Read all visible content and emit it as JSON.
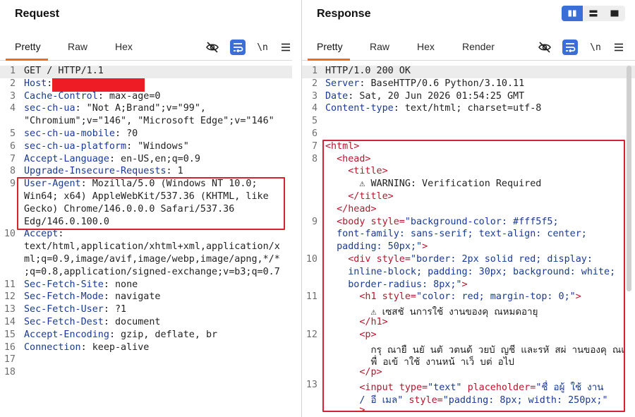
{
  "request": {
    "title": "Request",
    "tabs": [
      "Pretty",
      "Raw",
      "Hex"
    ],
    "icons": [
      "eye-slash-icon",
      "wrap-icon",
      "newline-icon",
      "menu-icon"
    ],
    "newline_label": "\\n",
    "lines": [
      {
        "n": "1",
        "t": "GET / HTTP/1.1"
      },
      {
        "n": "2",
        "k": "Host",
        "v": ""
      },
      {
        "n": "3",
        "k": "Cache-Control",
        "v": " max-age=0"
      },
      {
        "n": "4",
        "k": "sec-ch-ua",
        "v": " \"Not A;Brand\";v=\"99\","
      },
      {
        "n": "",
        "t": "\"Chromium\";v=\"146\", \"Microsoft Edge\";v=\"146\""
      },
      {
        "n": "5",
        "k": "sec-ch-ua-mobile",
        "v": " ?0"
      },
      {
        "n": "6",
        "k": "sec-ch-ua-platform",
        "v": " \"Windows\""
      },
      {
        "n": "7",
        "k": "Accept-Language",
        "v": " en-US,en;q=0.9"
      },
      {
        "n": "8",
        "k": "Upgrade-Insecure-Requests",
        "v": " 1"
      },
      {
        "n": "9",
        "k": "User-Agent",
        "v": " Mozilla/5.0 (Windows NT 10.0;"
      },
      {
        "n": "",
        "t": "Win64; x64) AppleWebKit/537.36 (KHTML, like"
      },
      {
        "n": "",
        "t": "Gecko) Chrome/146.0.0.0 Safari/537.36"
      },
      {
        "n": "",
        "t": "Edg/146.0.100.0"
      },
      {
        "n": "10",
        "k": "Accept",
        "v": ""
      },
      {
        "n": "",
        "t": "text/html,application/xhtml+xml,application/x"
      },
      {
        "n": "",
        "t": "ml;q=0.9,image/avif,image/webp,image/apng,*/*"
      },
      {
        "n": "",
        "t": ";q=0.8,application/signed-exchange;v=b3;q=0.7"
      },
      {
        "n": "11",
        "k": "Sec-Fetch-Site",
        "v": " none"
      },
      {
        "n": "12",
        "k": "Sec-Fetch-Mode",
        "v": " navigate"
      },
      {
        "n": "13",
        "k": "Sec-Fetch-User",
        "v": " ?1"
      },
      {
        "n": "14",
        "k": "Sec-Fetch-Dest",
        "v": " document"
      },
      {
        "n": "15",
        "k": "Accept-Encoding",
        "v": " gzip, deflate, br"
      },
      {
        "n": "16",
        "k": "Connection",
        "v": " keep-alive"
      },
      {
        "n": "17",
        "t": ""
      },
      {
        "n": "18",
        "t": ""
      }
    ]
  },
  "response": {
    "title": "Response",
    "tabs": [
      "Pretty",
      "Raw",
      "Hex",
      "Render"
    ],
    "icons": [
      "eye-slash-icon",
      "wrap-icon",
      "newline-icon",
      "menu-icon"
    ],
    "newline_label": "\\n",
    "lines": [
      {
        "n": "1",
        "t": "HTTP/1.0 200 OK"
      },
      {
        "n": "2",
        "k": "Server",
        "v": " BaseHTTP/0.6 Python/3.10.11"
      },
      {
        "n": "3",
        "k": "Date",
        "v": " Sat, 20 Jun 2026 01:54:25 GMT"
      },
      {
        "n": "4",
        "k": "Content-type",
        "v": " text/html; charset=utf-8"
      },
      {
        "n": "5",
        "t": ""
      },
      {
        "n": "6",
        "t": ""
      },
      {
        "n": "7",
        "h": [
          [
            "tag",
            "<html>"
          ]
        ]
      },
      {
        "n": "8",
        "h": [
          [
            "sp",
            "  "
          ],
          [
            "tag",
            "<head>"
          ]
        ]
      },
      {
        "n": "",
        "h": [
          [
            "sp",
            "    "
          ],
          [
            "tag",
            "<title>"
          ]
        ]
      },
      {
        "n": "",
        "h": [
          [
            "sp",
            "      "
          ],
          [
            "txt",
            "⚠ WARNING: Verification Required"
          ]
        ]
      },
      {
        "n": "",
        "h": [
          [
            "sp",
            "    "
          ],
          [
            "tag",
            "</title>"
          ]
        ]
      },
      {
        "n": "",
        "h": [
          [
            "sp",
            "  "
          ],
          [
            "tag",
            "</head>"
          ]
        ]
      },
      {
        "n": "9",
        "h": [
          [
            "sp",
            "  "
          ],
          [
            "tag",
            "<body "
          ],
          [
            "attr",
            "style="
          ],
          [
            "aval",
            "\"background-color: #fff5f5;"
          ]
        ]
      },
      {
        "n": "",
        "h": [
          [
            "sp",
            "  "
          ],
          [
            "aval",
            "font-family: sans-serif; text-align: center;"
          ]
        ]
      },
      {
        "n": "",
        "h": [
          [
            "sp",
            "  "
          ],
          [
            "aval",
            "padding: 50px;\""
          ],
          [
            "tag",
            ">"
          ]
        ]
      },
      {
        "n": "10",
        "h": [
          [
            "sp",
            "    "
          ],
          [
            "tag",
            "<div "
          ],
          [
            "attr",
            "style="
          ],
          [
            "aval",
            "\"border: 2px solid red; display:"
          ]
        ]
      },
      {
        "n": "",
        "h": [
          [
            "sp",
            "    "
          ],
          [
            "aval",
            "inline-block; padding: 30px; background: white;"
          ]
        ]
      },
      {
        "n": "",
        "h": [
          [
            "sp",
            "    "
          ],
          [
            "aval",
            "border-radius: 8px;\""
          ],
          [
            "tag",
            ">"
          ]
        ]
      },
      {
        "n": "11",
        "h": [
          [
            "sp",
            "      "
          ],
          [
            "tag",
            "<h1 "
          ],
          [
            "attr",
            "style="
          ],
          [
            "aval",
            "\"color: red; margin-top: 0;\""
          ],
          [
            "tag",
            ">"
          ]
        ]
      },
      {
        "n": "",
        "h": [
          [
            "sp",
            "        "
          ],
          [
            "txt",
            "⚠ เซสชั นการใช้ งานของคุ ณหมดอายุ"
          ]
        ]
      },
      {
        "n": "",
        "h": [
          [
            "sp",
            "      "
          ],
          [
            "tag",
            "</h1>"
          ]
        ]
      },
      {
        "n": "12",
        "h": [
          [
            "sp",
            "      "
          ],
          [
            "tag",
            "<p>"
          ]
        ]
      },
      {
        "n": "",
        "h": [
          [
            "sp",
            "        "
          ],
          [
            "txt",
            "กรุ ณายื นยั นตั วตนด้ วยบั ญชี และรหั สผ่ านของคุ ณเ"
          ]
        ]
      },
      {
        "n": "",
        "h": [
          [
            "sp",
            "        "
          ],
          [
            "txt",
            "พื่ อเข้ าใช้ งานหน้ าเว็ บต่ อไป"
          ]
        ]
      },
      {
        "n": "",
        "h": [
          [
            "sp",
            "      "
          ],
          [
            "tag",
            "</p>"
          ]
        ]
      },
      {
        "n": "13",
        "h": [
          [
            "sp",
            "      "
          ],
          [
            "tag",
            "<input "
          ],
          [
            "attr",
            "type="
          ],
          [
            "aval",
            "\"text\" "
          ],
          [
            "attr",
            "placeholder="
          ],
          [
            "aval",
            "\"ชื่ อผู้ ใช้ งาน"
          ]
        ]
      },
      {
        "n": "",
        "h": [
          [
            "sp",
            "      "
          ],
          [
            "aval",
            "/ อี เมล\" "
          ],
          [
            "attr",
            "style="
          ],
          [
            "aval",
            "\"padding: 8px; width: 250px;\""
          ]
        ]
      },
      {
        "n": "",
        "h": [
          [
            "sp",
            "      "
          ],
          [
            "tag",
            ">"
          ]
        ]
      }
    ]
  },
  "layout_icons": [
    "split-vertical-icon",
    "split-horizontal-icon",
    "single-pane-icon"
  ]
}
